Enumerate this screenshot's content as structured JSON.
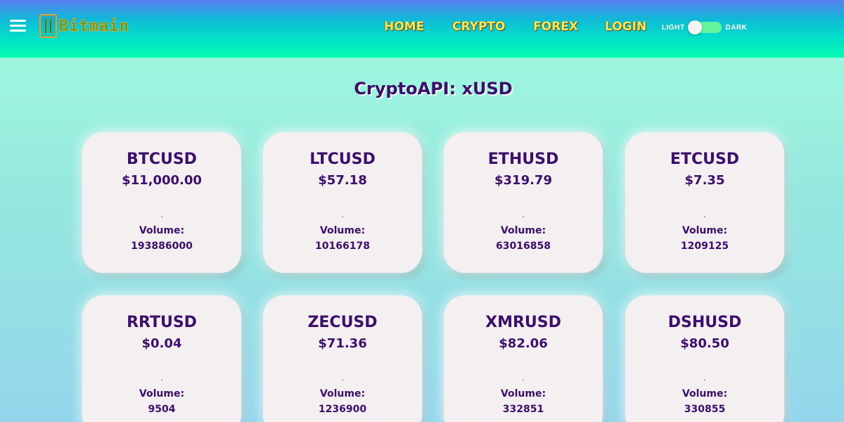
{
  "nav": {
    "logo_text": "Bitmain",
    "links": [
      {
        "label": "HOME"
      },
      {
        "label": "CRYPTO"
      },
      {
        "label": "FOREX"
      },
      {
        "label": "LOGIN"
      }
    ],
    "theme_toggle": {
      "light_label": "LIGHT",
      "dark_label": "DARK",
      "state": "light"
    },
    "menu_icon": "hamburger-menu-icon"
  },
  "page": {
    "title": "CryptoAPI: xUSD"
  },
  "tickers": [
    {
      "symbol": "BTCUSD",
      "price": "$11,000.00",
      "volume_label": "Volume:",
      "volume": "193886000"
    },
    {
      "symbol": "LTCUSD",
      "price": "$57.18",
      "volume_label": "Volume:",
      "volume": "10166178"
    },
    {
      "symbol": "ETHUSD",
      "price": "$319.79",
      "volume_label": "Volume:",
      "volume": "63016858"
    },
    {
      "symbol": "ETCUSD",
      "price": "$7.35",
      "volume_label": "Volume:",
      "volume": "1209125"
    },
    {
      "symbol": "RRTUSD",
      "price": "$0.04",
      "volume_label": "Volume:",
      "volume": "9504"
    },
    {
      "symbol": "ZECUSD",
      "price": "$71.36",
      "volume_label": "Volume:",
      "volume": "1236900"
    },
    {
      "symbol": "XMRUSD",
      "price": "$82.06",
      "volume_label": "Volume:",
      "volume": "332851"
    },
    {
      "symbol": "DSHUSD",
      "price": "$80.50",
      "volume_label": "Volume:",
      "volume": "330855"
    }
  ],
  "colors": {
    "text_primary": "#3d0f6c",
    "nav_link": "#f3e85d",
    "card_bg": "#f4f0f1",
    "toggle_track": "#62f59b"
  }
}
